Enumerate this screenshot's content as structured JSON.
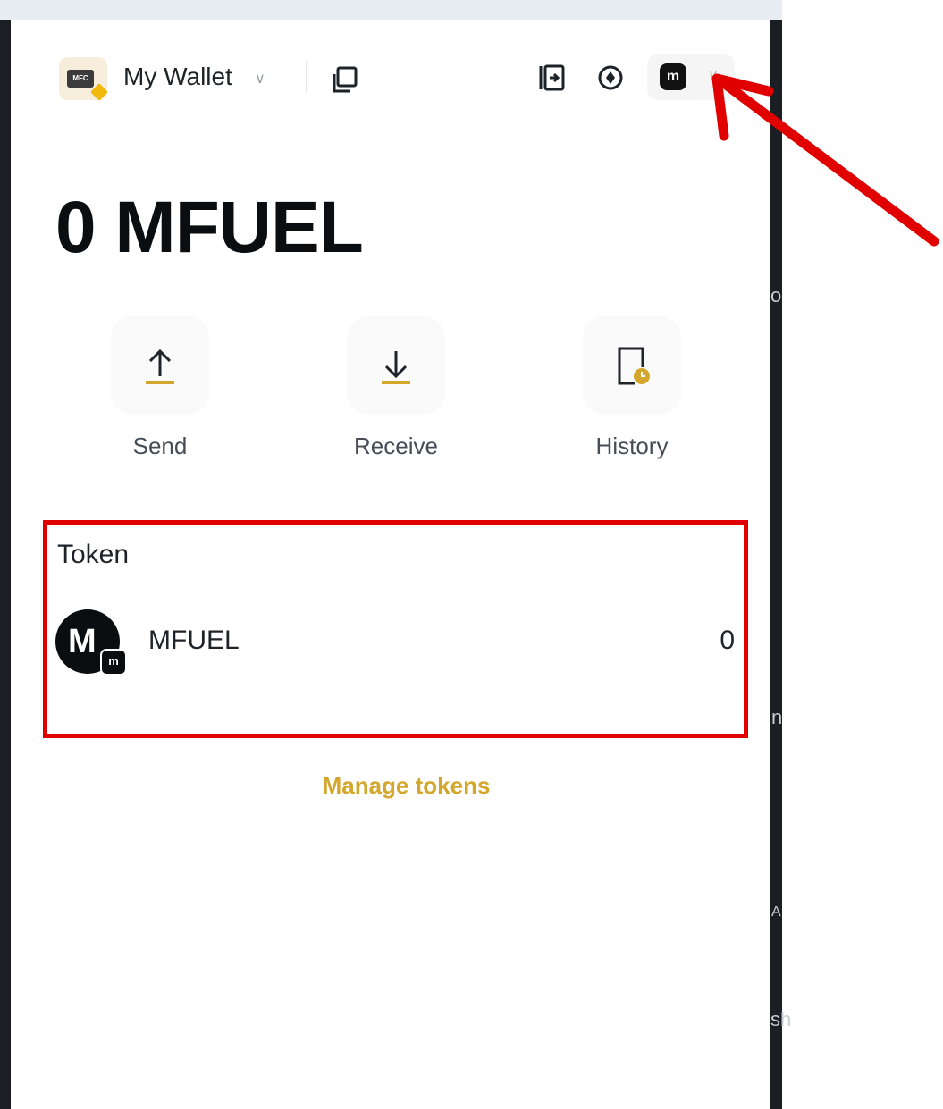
{
  "header": {
    "logo_text": "MFC",
    "wallet_name": "My Wallet",
    "account_badge": "m"
  },
  "balance": {
    "amount": "0 MFUEL"
  },
  "actions": [
    {
      "label": "Send",
      "icon": "arrow-up-icon"
    },
    {
      "label": "Receive",
      "icon": "arrow-down-icon"
    },
    {
      "label": "History",
      "icon": "history-icon"
    }
  ],
  "tokens": {
    "title": "Token",
    "items": [
      {
        "avatar_letter": "M",
        "avatar_sub": "m",
        "name": "MFUEL",
        "amount": "0"
      }
    ],
    "manage_label": "Manage tokens"
  },
  "edge_fragments": [
    "o",
    "n",
    "A",
    "sh"
  ],
  "colors": {
    "accent": "#d4a72c",
    "annotation": "#e00000",
    "text": "#1e2329"
  }
}
